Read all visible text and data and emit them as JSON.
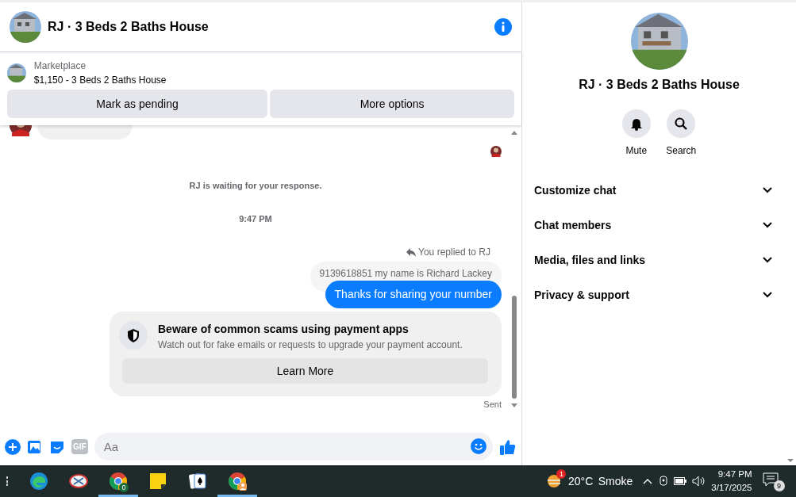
{
  "header": {
    "title": "RJ · 3 Beds 2 Baths House"
  },
  "listing": {
    "source": "Marketplace",
    "title": "$1,150 - 3 Beds 2 Baths House",
    "buttons": [
      "Mark as pending",
      "More options"
    ]
  },
  "messages": [
    {
      "kind": "incoming_cut"
    },
    {
      "kind": "read_receipt"
    },
    {
      "kind": "notice",
      "text": "RJ is waiting for your response."
    },
    {
      "kind": "timestamp",
      "text": "9:47 PM"
    },
    {
      "kind": "reply_label",
      "text": "You replied to RJ"
    },
    {
      "kind": "quoted",
      "text": "9139618851 my name is Richard Lackey"
    },
    {
      "kind": "outgoing",
      "text": "Thanks for sharing your number"
    },
    {
      "kind": "warning",
      "title": "Beware of common scams using payment apps",
      "body": "Watch out for fake emails or requests to upgrade your payment account.",
      "button": "Learn More"
    },
    {
      "kind": "status",
      "text": "Sent"
    }
  ],
  "composer": {
    "placeholder": "Aa",
    "gif": "GIF"
  },
  "details": {
    "title": "RJ · 3 Beds 2 Baths House",
    "actions": [
      {
        "kind": "mute",
        "label": "Mute"
      },
      {
        "kind": "search",
        "label": "Search"
      }
    ],
    "sections": [
      {
        "label": "Customize chat",
        "expanded": false
      },
      {
        "label": "Chat members",
        "expanded": false
      },
      {
        "label": "Media, files and links",
        "expanded": false
      },
      {
        "label": "Privacy & support",
        "expanded": false
      }
    ]
  },
  "taskbar": {
    "apps": [
      {
        "kind": "edge",
        "running": false
      },
      {
        "kind": "snip",
        "running": false
      },
      {
        "kind": "chrome",
        "running": true,
        "badge": "0"
      },
      {
        "kind": "notes",
        "running": false
      },
      {
        "kind": "cards",
        "running": false
      },
      {
        "kind": "chrome_profile",
        "running": true
      }
    ],
    "weather": {
      "temp": "20°C",
      "condition": "Smoke",
      "badge": "1"
    },
    "time": "9:47 PM",
    "date": "3/17/2025",
    "notifications": "9"
  }
}
